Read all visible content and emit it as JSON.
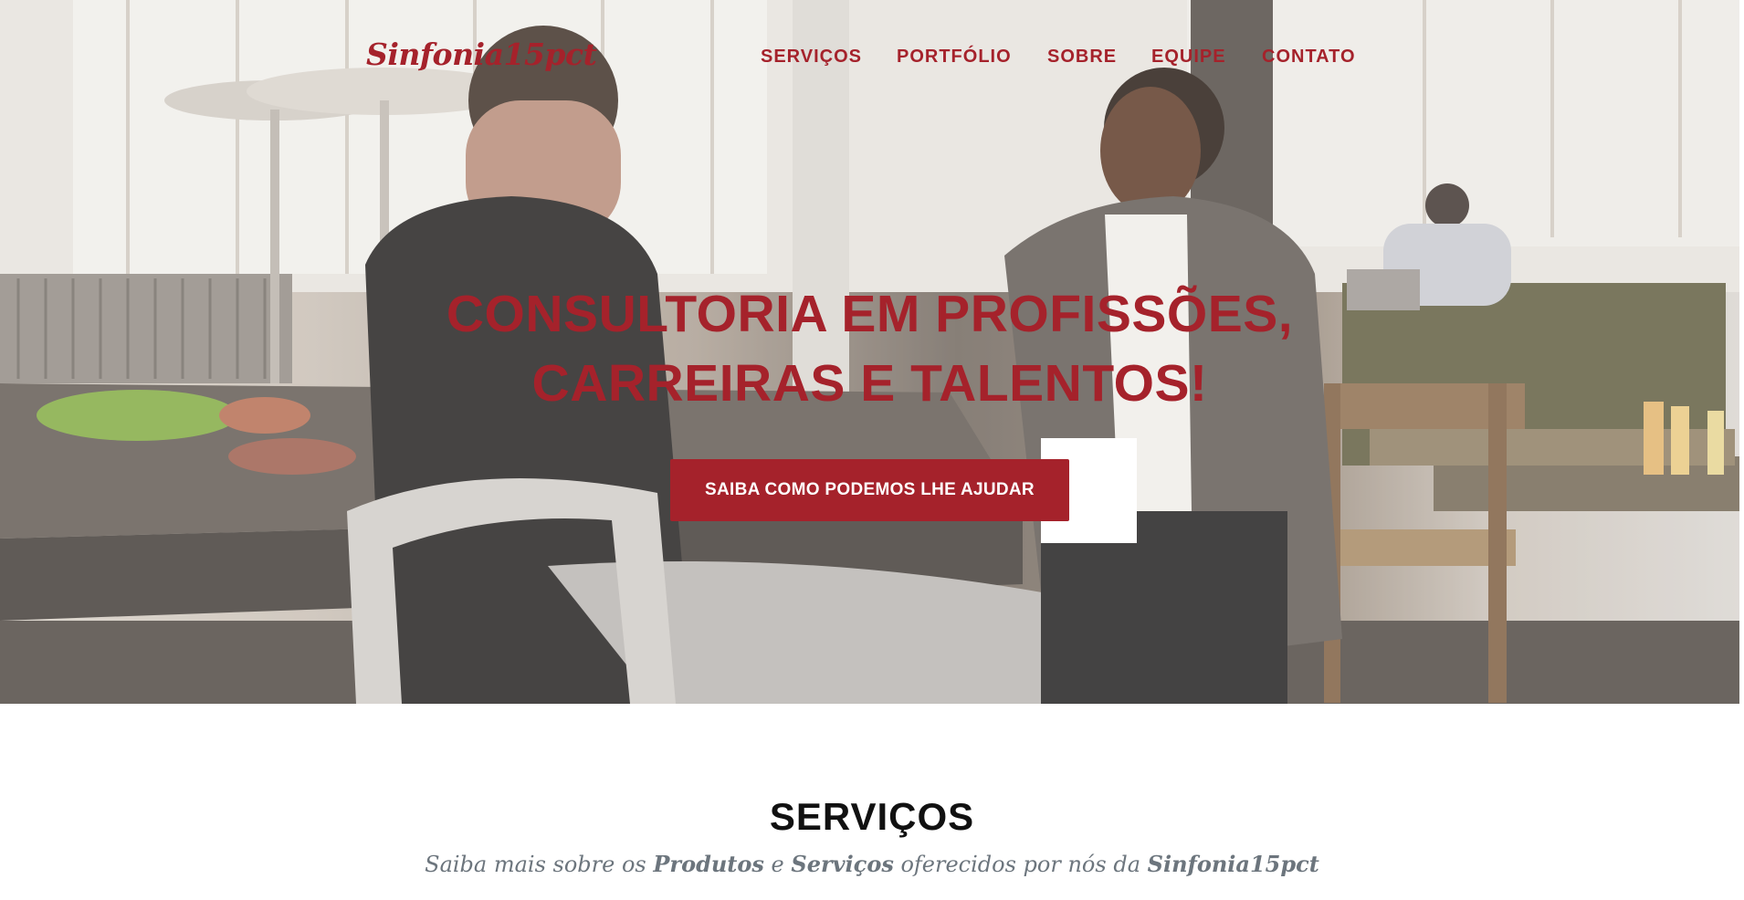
{
  "brand": "Sinfonia15pct",
  "nav": {
    "items": [
      {
        "label": "SERVIÇOS"
      },
      {
        "label": "PORTFÓLIO"
      },
      {
        "label": "SOBRE"
      },
      {
        "label": "EQUIPE"
      },
      {
        "label": "CONTATO"
      }
    ]
  },
  "hero": {
    "title_line1": "CONSULTORIA EM PROFISSÕES,",
    "title_line2": "CARREIRAS E TALENTOS!",
    "cta": "SAIBA COMO PODEMOS LHE AJUDAR"
  },
  "services": {
    "title": "SERVIÇOS",
    "subtitle_parts": {
      "p1": "Saiba mais sobre os ",
      "b1": "Produtos",
      "p2": " e ",
      "b2": "Serviços",
      "p3": " oferecidos por nós da ",
      "b3": "Sinfonia15pct"
    }
  },
  "colors": {
    "accent": "#a5222b",
    "text_dark": "#111111",
    "text_muted": "#6c757d"
  }
}
